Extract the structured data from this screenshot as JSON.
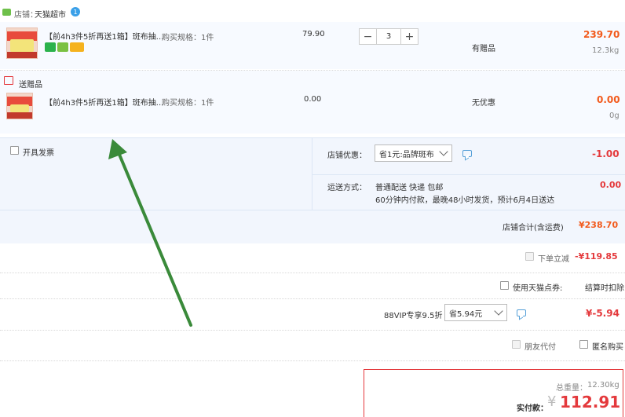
{
  "store": {
    "label": "店铺：",
    "name": "天猫超市",
    "badge": "1"
  },
  "items": [
    {
      "title": "【前4h3件5折再送1箱】斑布抽...",
      "spec": "购买规格：1件",
      "price": "79.90",
      "quantity": "3",
      "gift_note": "有赠品",
      "subtotal": "239.70",
      "weight": "12.3kg"
    }
  ],
  "gift_section": {
    "label": "送赠品",
    "title": "【前4h3件5折再送1箱】斑布抽...",
    "spec": "购买规格：1件",
    "price": "0.00",
    "promo": "无优惠",
    "subtotal": "0.00",
    "weight": "0g"
  },
  "invoice": {
    "label": "开具发票"
  },
  "store_discount": {
    "label": "店铺优惠：",
    "selected": "省1元:品牌斑布",
    "amount": "-1.00"
  },
  "shipping": {
    "label": "运送方式：",
    "method": "普通配送 快递 包邮",
    "detail": "60分钟内付款，最晚48小时发货，预计6月4日送达",
    "amount": "0.00"
  },
  "store_total": {
    "label": "店铺合计(含运费)",
    "amount": "¥238.70"
  },
  "instant_discount": {
    "label": "下单立减",
    "amount": "-¥119.85"
  },
  "tmall_points": {
    "label": "使用天猫点券:",
    "note": "结算时扣除"
  },
  "vip": {
    "label": "88VIP专享9.5折",
    "selected": "省5.94元",
    "amount": "¥-5.94"
  },
  "options": {
    "friend_pay": "朋友代付",
    "anonymous": "匿名购买"
  },
  "summary": {
    "weight_label": "总重量：",
    "weight": "12.30kg",
    "pay_label": "实付款：",
    "currency": "¥",
    "amount": "112.91"
  },
  "colors": {
    "accent_red": "#e4393c",
    "accent_orange": "#f25a1c",
    "arrow_green": "#3a8a3a",
    "panel_blue": "#f2f6fd"
  }
}
